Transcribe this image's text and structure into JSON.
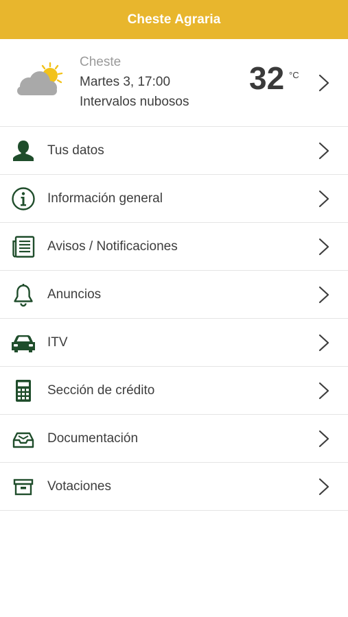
{
  "app": {
    "title": "Cheste Agraria"
  },
  "weather": {
    "city": "Cheste",
    "datetime": "Martes 3, 17:00",
    "condition": "Intervalos nubosos",
    "temperature": "32",
    "unit": "°C",
    "icon": "partly-cloudy-icon"
  },
  "menu": {
    "items": [
      {
        "label": "Tus datos",
        "icon": "person-icon"
      },
      {
        "label": "Información general",
        "icon": "info-icon"
      },
      {
        "label": "Avisos / Notificaciones",
        "icon": "newspaper-icon"
      },
      {
        "label": "Anuncios",
        "icon": "bell-icon"
      },
      {
        "label": "ITV",
        "icon": "car-icon"
      },
      {
        "label": "Sección de crédito",
        "icon": "calculator-icon"
      },
      {
        "label": "Documentación",
        "icon": "inbox-icon"
      },
      {
        "label": "Votaciones",
        "icon": "archive-box-icon"
      }
    ]
  },
  "colors": {
    "header": "#e8b62d",
    "icon_green": "#1f4d2b",
    "sun": "#f2c21b",
    "cloud": "#a9a9a9"
  }
}
